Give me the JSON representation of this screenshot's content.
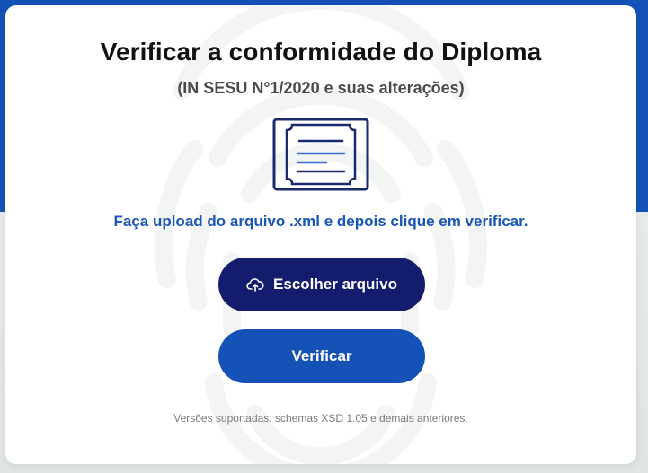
{
  "page": {
    "title": "Verificar a conformidade do Diploma",
    "subtitle": "(IN SESU N°1/2020 e suas alterações)",
    "instruction": "Faça upload do arquivo .xml e depois clique em verificar.",
    "footer_note": "Versões suportadas: schemas XSD 1.05 e demais anteriores."
  },
  "buttons": {
    "choose_file": "Escolher arquivo",
    "verify": "Verificar"
  },
  "icons": {
    "diploma": "diploma-icon",
    "upload": "cloud-upload-icon",
    "watermark": "fingerprint-icon"
  },
  "colors": {
    "header_blue": "#1452b8",
    "choose_button": "#141c6e",
    "verify_button": "#1452b8",
    "instruction_text": "#1a56b4"
  }
}
